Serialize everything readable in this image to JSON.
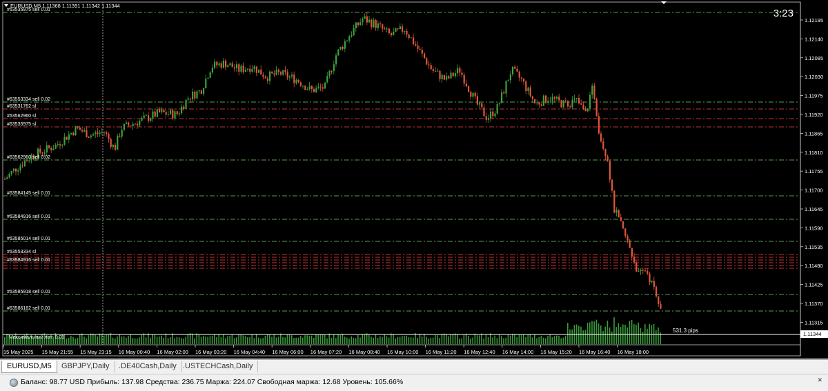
{
  "chart": {
    "symbol_header": "EURUSD,M5  1.11368 1.11391 1.11342 1.11344",
    "timer": "3:23",
    "bid_label": "1.11344",
    "pips_label": "531.3 pips",
    "max_lot_label": "Максимальный лот: 0.01",
    "price_axis": [
      "1.12195",
      "1.12140",
      "1.12085",
      "1.12030",
      "1.11975",
      "1.11920",
      "1.11865",
      "1.11810",
      "1.11755",
      "1.11700",
      "1.11645",
      "1.11590",
      "1.11535",
      "1.11480",
      "1.11425",
      "1.11370",
      "1.11315"
    ],
    "time_axis": [
      "15 May 2025",
      "15 May 21:55",
      "15 May 23:15",
      "16 May 00:40",
      "16 May 02:00",
      "16 May 03:20",
      "16 May 04:40",
      "16 May 06:00",
      "16 May 07:20",
      "16 May 08:40",
      "16 May 10:00",
      "16 May 11:20",
      "16 May 12:40",
      "16 May 14:00",
      "16 May 15:20",
      "16 May 16:40",
      "16 May 18:00"
    ],
    "order_labels": [
      "#63535975 sell 0.01",
      "#63553334 sell 0.02",
      "#63531762 sl",
      "#63562960 sl",
      "#63535975 sl",
      "#63562960 sell 0.02",
      "#63584145 sell 0.01",
      "#63584916 sell 0.01",
      "#63585014 sell 0.01",
      "#63553334 sl",
      "#63584916 sell 0.01",
      "#63585918 sell 0.01",
      "#63586182 sell 0.01"
    ],
    "colors": {
      "background": "#000000",
      "bull": "#3aa23a",
      "bear": "#e0573a",
      "order_line": "#5aa04a",
      "sl_line": "#c83232",
      "volume": "#3a9a3a"
    }
  },
  "tabs": [
    "EURUSD,M5",
    "GBPJPY,Daily",
    ".DE40Cash,Daily",
    ".USTECHCash,Daily"
  ],
  "status": {
    "text": "Баланс: 98.77 USD  Прибыль: 137.98  Средства: 236.75  Маржа: 224.07  Свободная маржа: 12.68  Уровень: 105.66%",
    "close_icon": "close-icon"
  }
}
